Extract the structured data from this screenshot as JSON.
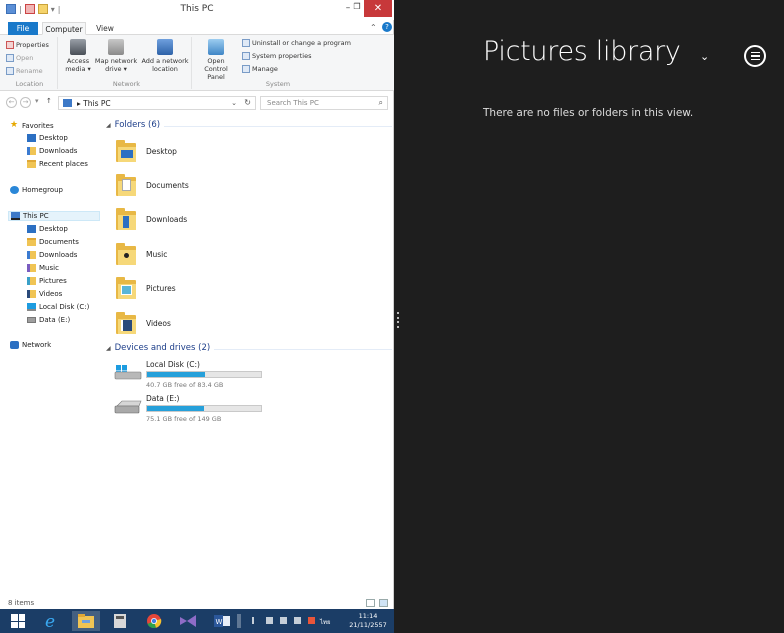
{
  "explorer": {
    "window_title": "This PC",
    "tabs": {
      "file": "File",
      "computer": "Computer",
      "view": "View"
    },
    "ribbon": {
      "location": {
        "label": "Location",
        "properties": "Properties",
        "open": "Open",
        "rename": "Rename"
      },
      "network": {
        "label": "Network",
        "access_media": "Access media ▾",
        "map_drive": "Map network drive ▾",
        "add_location": "Add a network location"
      },
      "system": {
        "label": "System",
        "open_control_panel": "Open Control Panel",
        "uninstall": "Uninstall or change a program",
        "system_properties": "System properties",
        "manage": "Manage"
      }
    },
    "address": {
      "path": "This PC",
      "search_placeholder": "Search This PC"
    },
    "nav": {
      "favorites": "Favorites",
      "desktop": "Desktop",
      "downloads": "Downloads",
      "recent": "Recent places",
      "homegroup": "Homegroup",
      "this_pc": "This PC",
      "pc_desktop": "Desktop",
      "pc_documents": "Documents",
      "pc_downloads": "Downloads",
      "pc_music": "Music",
      "pc_pictures": "Pictures",
      "pc_videos": "Videos",
      "local_disk": "Local Disk (C:)",
      "data": "Data (E:)",
      "network": "Network"
    },
    "folders_header": "Folders (6)",
    "folders": [
      "Desktop",
      "Documents",
      "Downloads",
      "Music",
      "Pictures",
      "Videos"
    ],
    "devices_header": "Devices and drives (2)",
    "drives": [
      {
        "name": "Local Disk (C:)",
        "free": "40.7 GB free of 83.4 GB",
        "used_fraction": 0.51
      },
      {
        "name": "Data (E:)",
        "free": "75.1 GB free of 149 GB",
        "used_fraction": 0.5
      }
    ],
    "status": "8 items"
  },
  "taskbar": {
    "time": "11:14",
    "date": "21/11/2557",
    "lang": "ไทย"
  },
  "photos": {
    "title": "Pictures library",
    "chevron": "⌄",
    "empty_message": "There are no files or folders in this view."
  },
  "colors": {
    "accent": "#1979ca",
    "drive_fill": "#26a0da",
    "dark_bg": "#1e1e1e",
    "taskbar": "#1b3d66"
  }
}
